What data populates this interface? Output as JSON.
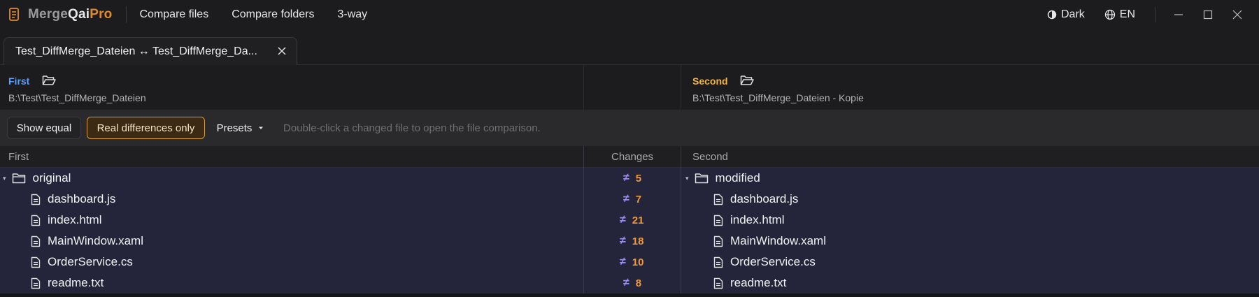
{
  "app": {
    "title_part1": "Merge",
    "title_part2": "Qai",
    "title_part3": "Pro"
  },
  "menu": [
    "Compare files",
    "Compare folders",
    "3-way"
  ],
  "title_right": {
    "theme": "Dark",
    "language": "EN"
  },
  "tab": {
    "label": "Test_DiffMerge_Dateien ↔ Test_DiffMerge_Da..."
  },
  "first": {
    "title": "First",
    "path": "B:\\Test\\Test_DiffMerge_Dateien"
  },
  "second": {
    "title": "Second",
    "path": "B:\\Test\\Test_DiffMerge_Dateien - Kopie"
  },
  "toolbar": {
    "show_equal": "Show equal",
    "real_diff": "Real differences only",
    "presets": "Presets",
    "hint": "Double-click a changed file to open the file comparison."
  },
  "columns": {
    "first": "First",
    "changes": "Changes",
    "second": "Second"
  },
  "colors": {
    "accent_orange": "#e08a2a",
    "first_blue": "#5aa0ff",
    "second_yellow": "#f2b43a"
  },
  "rows": [
    {
      "first": "original",
      "second": "modified",
      "changes": "5",
      "type": "folder"
    },
    {
      "first": "dashboard.js",
      "second": "dashboard.js",
      "changes": "7",
      "type": "file"
    },
    {
      "first": "index.html",
      "second": "index.html",
      "changes": "21",
      "type": "file"
    },
    {
      "first": "MainWindow.xaml",
      "second": "MainWindow.xaml",
      "changes": "18",
      "type": "file"
    },
    {
      "first": "OrderService.cs",
      "second": "OrderService.cs",
      "changes": "10",
      "type": "file"
    },
    {
      "first": "readme.txt",
      "second": "readme.txt",
      "changes": "8",
      "type": "file"
    }
  ],
  "symbols": {
    "not_equal": "≠",
    "collapse": "▾"
  }
}
